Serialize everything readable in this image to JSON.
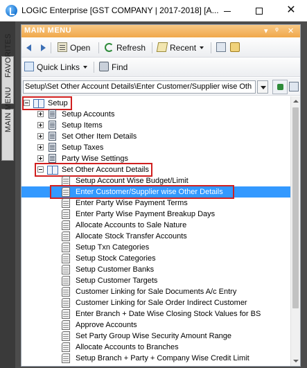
{
  "window": {
    "title": "LOGIC Enterprise [GST COMPANY  | 2017-2018] [A...",
    "minimize_icon": "minimize-icon",
    "maximize_icon": "maximize-icon",
    "close_glyph": "✕"
  },
  "side_tabs": {
    "favorites": "FAVORITES",
    "main_menu": "MAIN MENU"
  },
  "panel": {
    "title": "MAIN MENU",
    "header_controls": [
      "▾",
      "ᵠ",
      "✕"
    ],
    "header_color": "#f0a84a"
  },
  "toolbar": {
    "open": "Open",
    "refresh": "Refresh",
    "recent": "Recent",
    "quick_links": "Quick Links",
    "find": "Find"
  },
  "path": {
    "value": "Setup\\Set Other Account Details\\Enter Customer/Supplier wise Oth"
  },
  "tree": {
    "root": "Setup",
    "children": [
      "Setup Accounts",
      "Setup Items",
      "Set Other Item Details",
      "Setup Taxes",
      "Party Wise Settings",
      "Set Other Account Details"
    ],
    "items": [
      "Setup Account Wise Budget/Limit",
      "Enter Customer/Supplier wise Other Details",
      "Enter Party Wise Payment Terms",
      "Enter Party Wise Payment Breakup Days",
      "Allocate Accounts to Sale Nature",
      "Allocate Stock Transfer Accounts",
      "Setup Txn Categories",
      "Setup Stock Categories",
      "Setup Customer Banks",
      "Setup Customer Targets",
      "Customer Linking for Sale Documents A/c Entry",
      "Customer Linking for Sale Order Indirect Customer",
      "Enter Branch + Date Wise Closing Stock Values for BS",
      "Approve Accounts",
      "Set Party Group Wise Security Amount Range",
      "Allocate Accounts to Branches",
      "Setup Branch + Party + Company Wise Credit Limit"
    ],
    "selected_index": 1,
    "selection_color": "#3399ff",
    "highlight_color": "#d01f1f"
  }
}
